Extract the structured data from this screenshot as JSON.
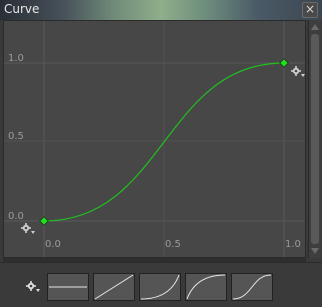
{
  "window": {
    "title": "Curve",
    "close_glyph": "×"
  },
  "axes": {
    "y_ticks": [
      "1.0",
      "0.5",
      "0.0"
    ],
    "x_ticks": [
      "0.0",
      "0.5",
      "1.0"
    ]
  },
  "curve": {
    "color": "#20c020",
    "key_color": "#20e020",
    "keys": [
      {
        "x": 0.0,
        "y": 0.0
      },
      {
        "x": 1.0,
        "y": 1.0
      }
    ]
  },
  "presets": [
    {
      "name": "constant"
    },
    {
      "name": "linear"
    },
    {
      "name": "ease-in"
    },
    {
      "name": "ease-out"
    },
    {
      "name": "ease-in-out"
    }
  ],
  "icons": {
    "gear": "gear-icon",
    "close": "close-icon"
  }
}
